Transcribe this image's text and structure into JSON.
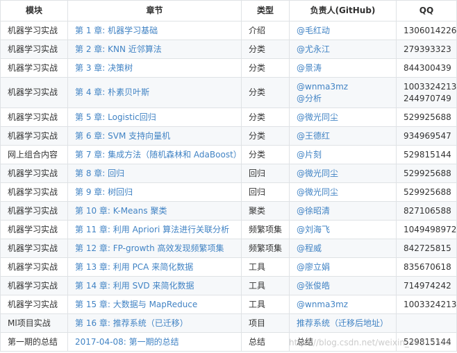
{
  "headers": [
    "模块",
    "章节",
    "类型",
    "负责人(GitHub)",
    "QQ"
  ],
  "rows": [
    {
      "module": "机器学习实战",
      "chapter": "第 1 章: 机器学习基础",
      "type": "介绍",
      "owners": [
        "@毛红动"
      ],
      "qq": [
        "1306014226"
      ]
    },
    {
      "module": "机器学习实战",
      "chapter": "第 2 章: KNN 近邻算法",
      "type": "分类",
      "owners": [
        "@尤永江"
      ],
      "qq": [
        "279393323"
      ]
    },
    {
      "module": "机器学习实战",
      "chapter": "第 3 章: 决策树",
      "type": "分类",
      "owners": [
        "@景涛"
      ],
      "qq": [
        "844300439"
      ]
    },
    {
      "module": "机器学习实战",
      "chapter": "第 4 章: 朴素贝叶斯",
      "type": "分类",
      "owners": [
        "@wnma3mz",
        "@分析"
      ],
      "qq": [
        "1003324213",
        "244970749"
      ]
    },
    {
      "module": "机器学习实战",
      "chapter": "第 5 章: Logistic回归",
      "type": "分类",
      "owners": [
        "@微光同尘"
      ],
      "qq": [
        "529925688"
      ]
    },
    {
      "module": "机器学习实战",
      "chapter": "第 6 章: SVM 支持向量机",
      "type": "分类",
      "owners": [
        "@王德红"
      ],
      "qq": [
        "934969547"
      ]
    },
    {
      "module": "网上组合内容",
      "chapter": "第 7 章: 集成方法（随机森林和 AdaBoost）",
      "type": "分类",
      "owners": [
        "@片刻"
      ],
      "qq": [
        "529815144"
      ]
    },
    {
      "module": "机器学习实战",
      "chapter": "第 8 章: 回归",
      "type": "回归",
      "owners": [
        "@微光同尘"
      ],
      "qq": [
        "529925688"
      ]
    },
    {
      "module": "机器学习实战",
      "chapter": "第 9 章: 树回归",
      "type": "回归",
      "owners": [
        "@微光同尘"
      ],
      "qq": [
        "529925688"
      ]
    },
    {
      "module": "机器学习实战",
      "chapter": "第 10 章: K-Means 聚类",
      "type": "聚类",
      "owners": [
        "@徐昭清"
      ],
      "qq": [
        "827106588"
      ]
    },
    {
      "module": "机器学习实战",
      "chapter": "第 11 章: 利用 Apriori 算法进行关联分析",
      "type": "频繁项集",
      "owners": [
        "@刘海飞"
      ],
      "qq": [
        "1049498972"
      ]
    },
    {
      "module": "机器学习实战",
      "chapter": "第 12 章: FP-growth 高效发现频繁项集",
      "type": "频繁项集",
      "owners": [
        "@程威"
      ],
      "qq": [
        "842725815"
      ]
    },
    {
      "module": "机器学习实战",
      "chapter": "第 13 章: 利用 PCA 来简化数据",
      "type": "工具",
      "owners": [
        "@廖立娟"
      ],
      "qq": [
        "835670618"
      ]
    },
    {
      "module": "机器学习实战",
      "chapter": "第 14 章: 利用 SVD 来简化数据",
      "type": "工具",
      "owners": [
        "@张俊皓"
      ],
      "qq": [
        "714974242"
      ]
    },
    {
      "module": "机器学习实战",
      "chapter": "第 15 章: 大数据与 MapReduce",
      "type": "工具",
      "owners": [
        "@wnma3mz"
      ],
      "qq": [
        "1003324213"
      ]
    },
    {
      "module": "Ml项目实战",
      "chapter": "第 16 章: 推荐系统（已迁移）",
      "type": "项目",
      "owners": [
        "推荐系统（迁移后地址）"
      ],
      "qq": [
        ""
      ]
    },
    {
      "module": "第一期的总结",
      "chapter": "2017-04-08: 第一期的总结",
      "type": "总结",
      "owners": [
        "总结"
      ],
      "qq": [
        "529815144"
      ]
    }
  ],
  "watermark": "https://blog.csdn.net/weixin_44515573"
}
